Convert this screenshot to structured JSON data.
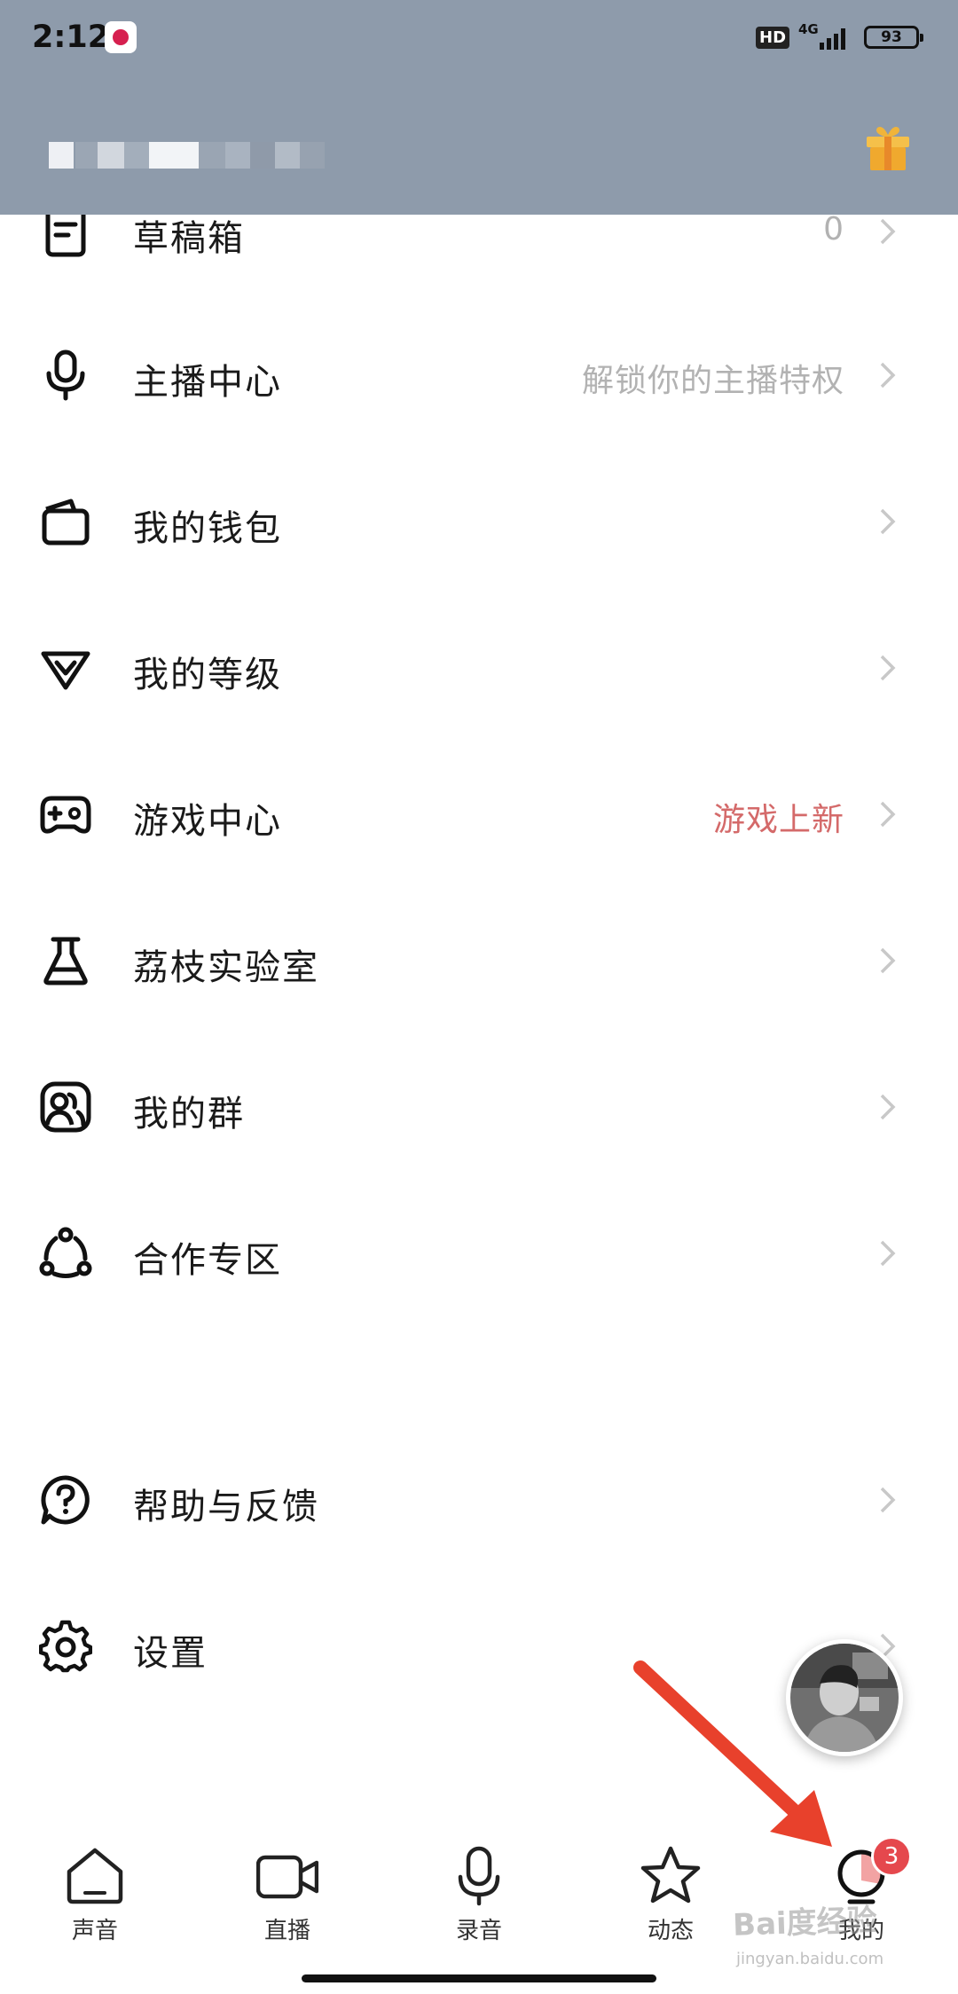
{
  "status_bar": {
    "time": "2:12",
    "network": "4G",
    "hd_label": "HD",
    "battery": "93"
  },
  "menu": {
    "items": [
      {
        "label": "草稿箱",
        "hint": "0",
        "icon": "draft-icon"
      },
      {
        "label": "主播中心",
        "hint": "解锁你的主播特权",
        "icon": "microphone-icon"
      },
      {
        "label": "我的钱包",
        "hint": "",
        "icon": "wallet-icon"
      },
      {
        "label": "我的等级",
        "hint": "",
        "icon": "level-diamond-icon"
      },
      {
        "label": "游戏中心",
        "hint": "游戏上新",
        "hint_color": "#d46a6a",
        "icon": "gamepad-icon"
      },
      {
        "label": "荔枝实验室",
        "hint": "",
        "icon": "flask-icon"
      },
      {
        "label": "我的群",
        "hint": "",
        "icon": "group-icon"
      },
      {
        "label": "合作专区",
        "hint": "",
        "icon": "cooperation-icon"
      },
      {
        "label": "帮助与反馈",
        "hint": "",
        "icon": "help-icon"
      },
      {
        "label": "设置",
        "hint": "",
        "icon": "gear-icon"
      }
    ]
  },
  "tabbar": {
    "tabs": [
      {
        "label": "声音",
        "icon": "home-icon"
      },
      {
        "label": "直播",
        "icon": "video-camera-icon"
      },
      {
        "label": "录音",
        "icon": "microphone-icon"
      },
      {
        "label": "动态",
        "icon": "star-icon"
      },
      {
        "label": "我的",
        "icon": "profile-icon"
      }
    ],
    "badge": "3"
  },
  "watermark": {
    "text": "Bai度经验",
    "sub": "jingyan.baidu.com"
  },
  "colors": {
    "header_bg": "#8e9bab",
    "hint_gray": "#b2b2b2",
    "hint_red": "#d46a6a",
    "badge_red": "#e5484d",
    "arrow_red": "#e8412c"
  }
}
